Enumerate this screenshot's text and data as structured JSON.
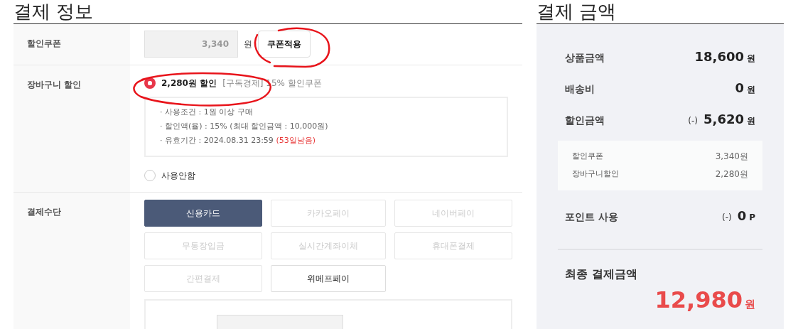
{
  "payment_info": {
    "title": "결제 정보",
    "coupon": {
      "label": "할인쿠폰",
      "value": "3,340",
      "unit": "원",
      "button": "쿠폰적용"
    },
    "cart_discount": {
      "label": "장바구니 할인",
      "options": [
        {
          "kind": "coupon",
          "label": "2,280원 할인",
          "note": "[구독경제] 15% 할인쿠폰",
          "selected": true
        },
        {
          "kind": "none",
          "label": "사용안함",
          "selected": false
        }
      ],
      "details": [
        {
          "text": "· 사용조건 : 1원 이상 구매"
        },
        {
          "text": "· 할인액(율) : 15% (최대 할인금액 : 10,000원)"
        },
        {
          "text": "· 유효기간 : 2024.08.31 23:59",
          "highlight": "(53일남음)"
        }
      ]
    },
    "method": {
      "label": "결제수단",
      "options": [
        {
          "label": "신용카드",
          "selected": true,
          "disabled": false
        },
        {
          "label": "카카오페이",
          "selected": false,
          "disabled": true
        },
        {
          "label": "네이버페이",
          "selected": false,
          "disabled": true
        },
        {
          "label": "무통장입금",
          "selected": false,
          "disabled": true
        },
        {
          "label": "실시간계좌이체",
          "selected": false,
          "disabled": true
        },
        {
          "label": "휴대폰결제",
          "selected": false,
          "disabled": true
        },
        {
          "label": "간편결제",
          "selected": false,
          "disabled": true
        },
        {
          "label": "위메프페이",
          "selected": false,
          "disabled": false
        }
      ]
    }
  },
  "summary": {
    "title": "결제 금액",
    "rows": [
      {
        "label": "상품금액",
        "amount": "18,600",
        "unit": "원"
      },
      {
        "label": "배송비",
        "amount": "0",
        "unit": "원"
      },
      {
        "label": "할인금액",
        "prefix": "(-)",
        "amount": "5,620",
        "unit": "원"
      }
    ],
    "breakdown": [
      {
        "label": "할인쿠폰",
        "amount": "3,340원"
      },
      {
        "label": "장바구니할인",
        "amount": "2,280원"
      }
    ],
    "points": {
      "label": "포인트 사용",
      "prefix": "(-)",
      "amount": "0",
      "unit": "P"
    },
    "total": {
      "label": "최종 결제금액",
      "amount": "12,980",
      "unit": "원"
    }
  },
  "annotations": [
    {
      "kind": "circle",
      "color": "#e8141b"
    },
    {
      "kind": "circle",
      "color": "#e8141b"
    }
  ]
}
